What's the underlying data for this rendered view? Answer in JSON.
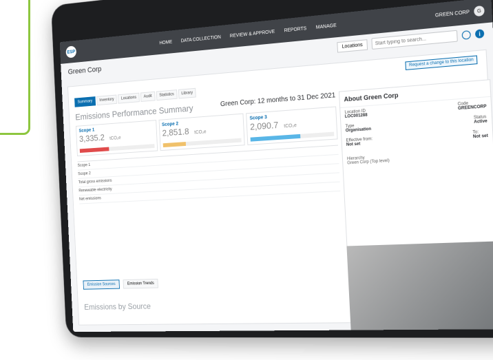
{
  "header": {
    "logo_text": "ESP",
    "nav": [
      "HOME",
      "DATA COLLECTION",
      "REVIEW & APPROVE",
      "REPORTS",
      "MANAGE"
    ],
    "user": "GREEN CORP",
    "avatar": "G"
  },
  "subbar": {
    "org": "Green Corp",
    "locations_label": "Locations",
    "search_placeholder": "Start typing to search..."
  },
  "content": {
    "request_button": "Request a change to this location",
    "tabs": [
      "Summary",
      "Inventory",
      "Locations",
      "Audit",
      "Statistics",
      "Library"
    ],
    "title": "Emissions Performance Summary",
    "period": "Green Corp: 12 months to 31 Dec 2021",
    "scopes": [
      {
        "name": "Scope 1",
        "value": "3,335.2",
        "unit": "tCO₂e"
      },
      {
        "name": "Scope 2",
        "value": "2,851.8",
        "unit": "tCO₂e"
      },
      {
        "name": "Scope 3",
        "value": "2,090.7",
        "unit": "tCO₂e"
      }
    ],
    "table_rows": [
      "Scope 1",
      "Scope 2",
      "Total gross emissions",
      "Renewable electricity",
      "Net emissions"
    ],
    "bottom_tabs": [
      "Emission Sources",
      "Emission Trends"
    ],
    "section_title": "Emissions by Source"
  },
  "about": {
    "title": "About Green Corp",
    "location_id_label": "Location ID",
    "location_id": "LOC001288",
    "code_label": "Code",
    "code": "GREENCORP",
    "type_label": "Type",
    "type": "Organisation",
    "status_label": "Status",
    "status": "Active",
    "effective_from_label": "Effective from:",
    "effective_from": "Not set",
    "to_label": "To:",
    "to": "Not set",
    "hierarchy_label": "Hierarchy",
    "hierarchy_value": "Green Corp (Top level)"
  },
  "colors": {
    "accent": "#0b6fb0",
    "frame": "#8dc63f",
    "danger": "#e04b4b"
  }
}
